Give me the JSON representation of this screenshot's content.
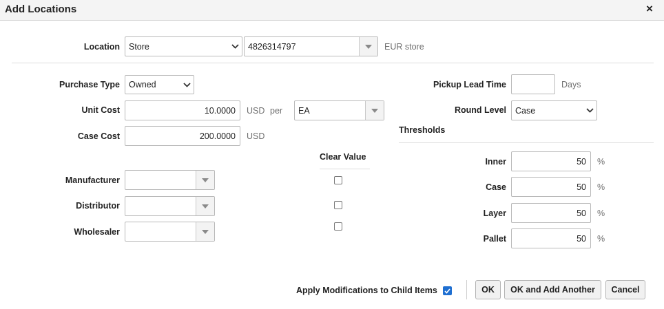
{
  "dialog": {
    "title": "Add Locations",
    "close_symbol": "×"
  },
  "location": {
    "label": "Location",
    "type_value": "Store",
    "id_value": "4826314797",
    "description": "EUR store"
  },
  "purchase_type": {
    "label": "Purchase Type",
    "value": "Owned"
  },
  "unit_cost": {
    "label": "Unit Cost",
    "value": "10.0000",
    "currency": "USD",
    "per": "per",
    "uom": "EA"
  },
  "case_cost": {
    "label": "Case Cost",
    "value": "200.0000",
    "currency": "USD"
  },
  "clear_value": {
    "label": "Clear Value"
  },
  "manufacturer": {
    "label": "Manufacturer",
    "value": ""
  },
  "distributor": {
    "label": "Distributor",
    "value": ""
  },
  "wholesaler": {
    "label": "Wholesaler",
    "value": ""
  },
  "pickup_lead_time": {
    "label": "Pickup Lead Time",
    "value": "",
    "unit": "Days"
  },
  "round_level": {
    "label": "Round Level",
    "value": "Case"
  },
  "thresholds": {
    "label": "Thresholds",
    "unit": "%",
    "inner": {
      "label": "Inner",
      "value": "50"
    },
    "case": {
      "label": "Case",
      "value": "50"
    },
    "layer": {
      "label": "Layer",
      "value": "50"
    },
    "pallet": {
      "label": "Pallet",
      "value": "50"
    }
  },
  "footer": {
    "apply_label": "Apply Modifications to Child Items",
    "apply_checked": true,
    "ok_label": "OK",
    "ok_add_label": "OK and Add Another",
    "cancel_label": "Cancel"
  },
  "colors": {
    "accent": "#1f6fd1",
    "border": "#b8b8b8",
    "muted_text": "#6f6f6f"
  },
  "icons": {
    "chevron": "chevron-down-icon",
    "dropdown": "triangle-down-icon",
    "check": "check-icon"
  }
}
